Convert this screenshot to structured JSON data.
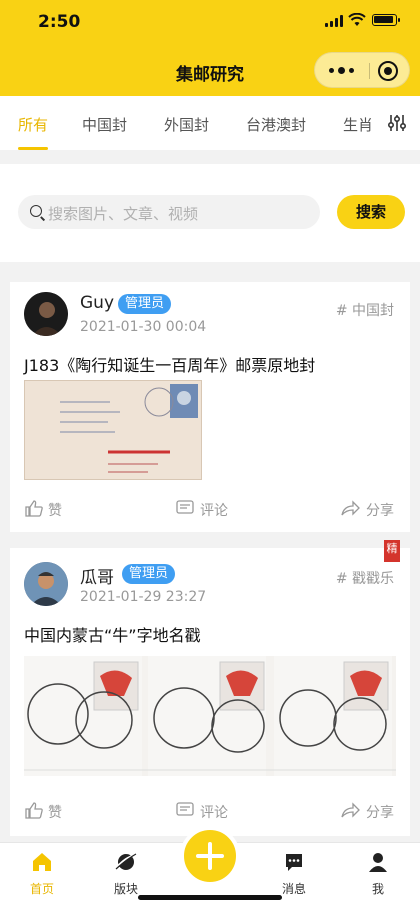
{
  "status_bar": {
    "time": "2:50"
  },
  "header": {
    "title": "集邮研究"
  },
  "tabs": [
    {
      "label": "所有",
      "active": true
    },
    {
      "label": "中国封",
      "active": false
    },
    {
      "label": "外国封",
      "active": false
    },
    {
      "label": "台港澳封",
      "active": false
    },
    {
      "label": "生肖",
      "active": false
    }
  ],
  "search": {
    "placeholder": "搜索图片、文章、视频",
    "button_label": "搜索"
  },
  "posts": [
    {
      "author": "Guy",
      "badge": "管理员",
      "time": "2021-01-30 00:04",
      "category": "# 中国封",
      "title": "J183《陶行知诞生一百周年》邮票原地封",
      "featured": false,
      "actions": {
        "like": "赞",
        "comment": "评论",
        "share": "分享"
      }
    },
    {
      "author": "瓜哥",
      "badge": "管理员",
      "time": "2021-01-29 23:27",
      "category": "# 戳戳乐",
      "title": "中国内蒙古“牛”字地名戳",
      "featured": true,
      "featured_label": "精",
      "actions": {
        "like": "赞",
        "comment": "评论",
        "share": "分享"
      }
    }
  ],
  "bottom_nav": [
    {
      "label": "首页",
      "icon": "home-icon",
      "active": true
    },
    {
      "label": "版块",
      "icon": "planet-icon",
      "active": false
    },
    {
      "label": "消息",
      "icon": "message-icon",
      "active": false
    },
    {
      "label": "我",
      "icon": "user-icon",
      "active": false
    }
  ],
  "colors": {
    "brand": "#f9d214",
    "active_tab": "#e8b600",
    "badge": "#3f9ef2",
    "featured": "#d4342c"
  }
}
